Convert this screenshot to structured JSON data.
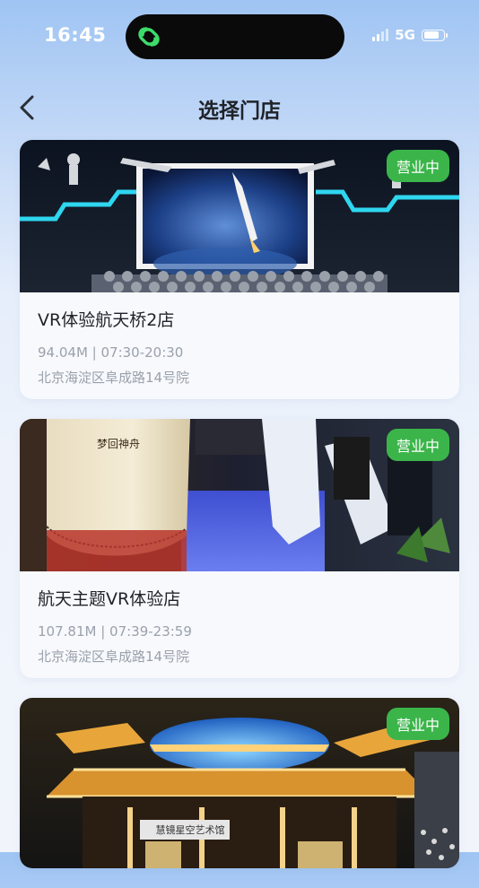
{
  "status_bar": {
    "time": "16:45",
    "network": "5G",
    "battery_level": 0.8,
    "app_icon": "link-loop-icon"
  },
  "header": {
    "title": "选择门店",
    "back_icon": "chevron-left-icon"
  },
  "stores": [
    {
      "name": "VR体验航天桥2店",
      "distance": "94.04M",
      "hours": "07:30-20:30",
      "address": "北京海淀区阜成路14号院",
      "status": "营业中",
      "image": "space-theater-photo",
      "image_sign": ""
    },
    {
      "name": "航天主题VR体验店",
      "distance": "107.81M",
      "hours": "07:39-23:59",
      "address": "北京海淀区阜成路14号院",
      "status": "营业中",
      "image": "vr-capsule-photo",
      "image_sign": "梦回神舟"
    },
    {
      "name": "",
      "distance": "",
      "hours": "",
      "address": "",
      "status": "营业中",
      "image": "lit-building-photo",
      "image_sign": "慧镜星空艺术馆"
    }
  ],
  "colors": {
    "badge": "#3bb54a",
    "title": "#1f2329",
    "secondary": "#9aa1ab",
    "card": "#f7f9fd"
  }
}
